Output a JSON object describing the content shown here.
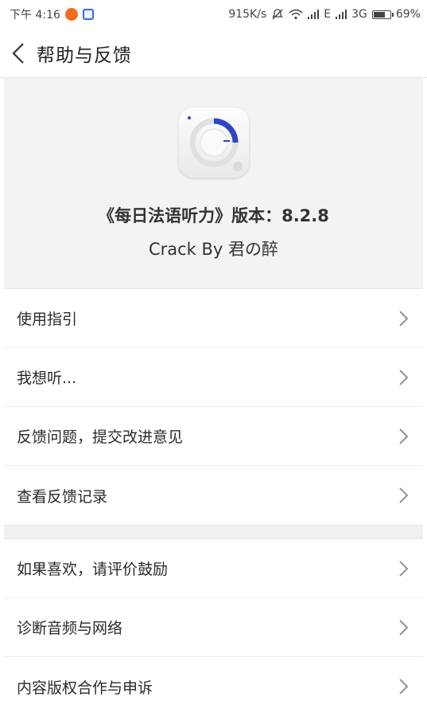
{
  "status_bar": {
    "time": "下午 4:16",
    "net_speed": "915K/s",
    "network": "E",
    "network2": "3G",
    "battery": "69%"
  },
  "nav": {
    "title": "帮助与反馈"
  },
  "header": {
    "version": "《每日法语听力》版本：8.2.8",
    "credit": "Crack By 君の醉"
  },
  "menu_group_1": [
    {
      "label": "使用指引"
    },
    {
      "label": "我想听..."
    },
    {
      "label": "反馈问题，提交改进意见"
    },
    {
      "label": "查看反馈记录"
    }
  ],
  "menu_group_2": [
    {
      "label": "如果喜欢，请评价鼓励"
    },
    {
      "label": "诊断音频与网络"
    },
    {
      "label": "内容版权合作与申诉"
    }
  ],
  "colors": {
    "accent": "#2f45c8",
    "notif_orange": "#f06d1e",
    "header_bg": "#f3f3f3"
  }
}
